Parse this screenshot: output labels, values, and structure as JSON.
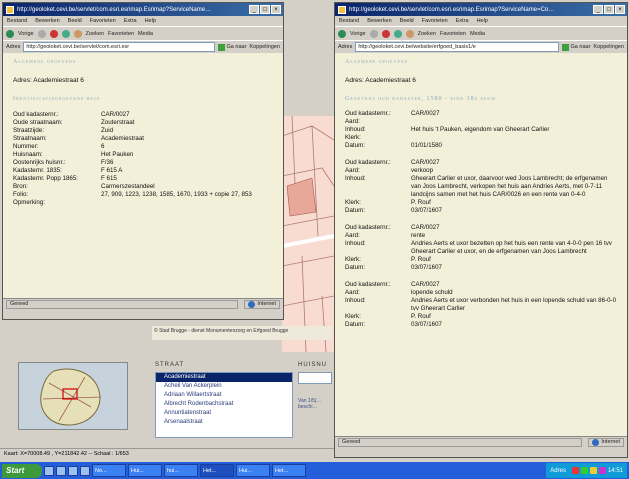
{
  "colors": {
    "title_bar": "#0a246a",
    "content_bg": "#f2f0d8",
    "section_heading": "#8aa6c8",
    "taskbar": "#245edb"
  },
  "map_app": {
    "map_caption": "© Stad Brugge - dienst Monumentenzorg en Erfgoed Brugge",
    "street_panel": {
      "title": "STRAAT",
      "streets": [
        "Academiestraat",
        "Acheil Van Ackerplein",
        "Adriaan Willaertstraat",
        "Albrecht Rodenbachstraat",
        "Annuntiatenstraat",
        "Arsenaalstraat"
      ],
      "selected_index": 0
    },
    "house_panel": {
      "title": "HUISNU",
      "text": "Van 1/5(… beschi…"
    },
    "coord_bar": "Kaart: X=70008.49 , Y=211842.42 -- Schaal : 1/653"
  },
  "window_left": {
    "title": "http://geoloket.cevi.be/servlet/com.esri.esrimap.Esrimap?ServiceName…",
    "menu": [
      "Bestand",
      "Bewerken",
      "Beeld",
      "Favorieten",
      "Extra",
      "Help"
    ],
    "toolbar": {
      "back": "Vorige",
      "search": "Zoeken",
      "favorites": "Favorieten",
      "media": "Media"
    },
    "address_label": "Adres",
    "address": "http://geoloket.cevi.be/servlet/com.esri.esr",
    "go": "Ga naar",
    "links": "Koppelingen",
    "heading1": "Algemene gegevens",
    "adres_line": "Adres: Academiestraat 6",
    "heading2": "Identificatiegegevens huis",
    "fields": [
      {
        "label": "Oud kadasternr.:",
        "value": "CAR/0027"
      },
      {
        "label": "Oude straatnaam:",
        "value": "Zouterstraat"
      },
      {
        "label": "Straatzijde:",
        "value": "Zuid"
      },
      {
        "label": "Straatnaam:",
        "value": "Academiestraat"
      },
      {
        "label": "Nummer:",
        "value": "6"
      },
      {
        "label": "Huisnaam:",
        "value": "Het Pauken"
      },
      {
        "label": "Oostenrijks huisnr.:",
        "value": "F/36"
      },
      {
        "label": "Kadasternr. 1835:",
        "value": "F 615 A"
      },
      {
        "label": "Kadasternr. Popp 1865:",
        "value": "F 615"
      },
      {
        "label": "Bron:",
        "value": "Carmerszestandeel"
      },
      {
        "label": "Folio:",
        "value": "27, 909, 1223, 1238, 1585, 1670, 1933 + copie 27, 853"
      },
      {
        "label": "Opmerking:",
        "value": ""
      }
    ],
    "status": "Gereed",
    "zone": "Internet"
  },
  "window_right": {
    "title": "http://geoloket.cevi.be/servlet/com.esri.esrimap.Esrimap?ServiceName=Co…",
    "menu": [
      "Bestand",
      "Bewerken",
      "Beeld",
      "Favorieten",
      "Extra",
      "Help"
    ],
    "toolbar": {
      "back": "Vorige",
      "search": "Zoeken",
      "favorites": "Favorieten",
      "media": "Media"
    },
    "address_label": "Adres",
    "address": "http://geoloket.cevi.be/website/erfgoed_basis1/e",
    "go": "Ga naar",
    "links": "Koppelingen",
    "heading1": "Algemene gegevens",
    "adres_line": "Adres: Academiestraat 6",
    "heading2": "Gegevens oud kadaster, 1580 - eind 18e eeuw",
    "records": [
      {
        "rows": [
          {
            "label": "Oud kadasternr.:",
            "value": "CAR/0027"
          },
          {
            "label": "Aard:",
            "value": ""
          },
          {
            "label": "Inhoud:",
            "value": "Het huis 't Pauken, eigendom van Gheerart Carlier"
          },
          {
            "label": "Klerk:",
            "value": ""
          },
          {
            "label": "Datum:",
            "value": "01/01/1580"
          }
        ]
      },
      {
        "rows": [
          {
            "label": "Oud kadasternr.:",
            "value": "CAR/0027"
          },
          {
            "label": "Aard:",
            "value": "verkoop"
          },
          {
            "label": "Inhoud:",
            "value": "Gheerart Carlier et uxor, daarvoor wed Joos Lambrecht; de erfgenamen van Joos Lambrecht, verkopen het huis aan Andries Aerts, met 0-7-11 landcijns samen met het huis CAR/0026 en een rente van 0-4-0"
          },
          {
            "label": "Klerk:",
            "value": "P. Rouf"
          },
          {
            "label": "Datum:",
            "value": "03/07/1607"
          }
        ]
      },
      {
        "rows": [
          {
            "label": "Oud kadasternr.:",
            "value": "CAR/0027"
          },
          {
            "label": "Aard:",
            "value": "rente"
          },
          {
            "label": "Inhoud:",
            "value": "Andries Aerts et uxor bezetten op het huis een rente van 4-0-0 pen 16 tvv Gheerart Carlier et uxor, en de erfgenamen van Joos Lambrecht"
          },
          {
            "label": "Klerk:",
            "value": "P. Rouf"
          },
          {
            "label": "Datum:",
            "value": "03/07/1607"
          }
        ]
      },
      {
        "rows": [
          {
            "label": "Oud kadasternr.:",
            "value": "CAR/0027"
          },
          {
            "label": "Aard:",
            "value": "lopende schuld"
          },
          {
            "label": "Inhoud:",
            "value": "Andries Aerts et uxor verbonden het huis in een lopende schuld van 86-0-0 tvv Gheerart Carlier"
          },
          {
            "label": "Klerk:",
            "value": "P. Rouf"
          },
          {
            "label": "Datum:",
            "value": "03/07/1607"
          }
        ]
      }
    ],
    "status": "Gereed",
    "zone": "Internet"
  },
  "taskbar": {
    "start": "Start",
    "tasks": [
      "No...",
      "Hui...",
      "hui...",
      "Het...",
      "Hui...",
      "Het..."
    ],
    "active_index": 3,
    "address_label": "Adres",
    "clock": "14:51"
  }
}
